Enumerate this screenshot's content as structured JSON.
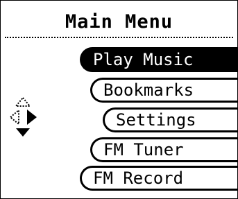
{
  "header": {
    "title": "Main Menu"
  },
  "menu": {
    "items": [
      {
        "label": "Play Music",
        "selected": true
      },
      {
        "label": "Bookmarks",
        "selected": false
      },
      {
        "label": "Settings",
        "selected": false
      },
      {
        "label": "FM Tuner",
        "selected": false
      },
      {
        "label": "FM Record",
        "selected": false
      }
    ]
  },
  "nav_indicator": {
    "icon": "dpad-arrows-icon"
  },
  "colors": {
    "foreground": "#000000",
    "background": "#ffffff",
    "selected_background": "#000000",
    "selected_text": "#ffffff"
  }
}
